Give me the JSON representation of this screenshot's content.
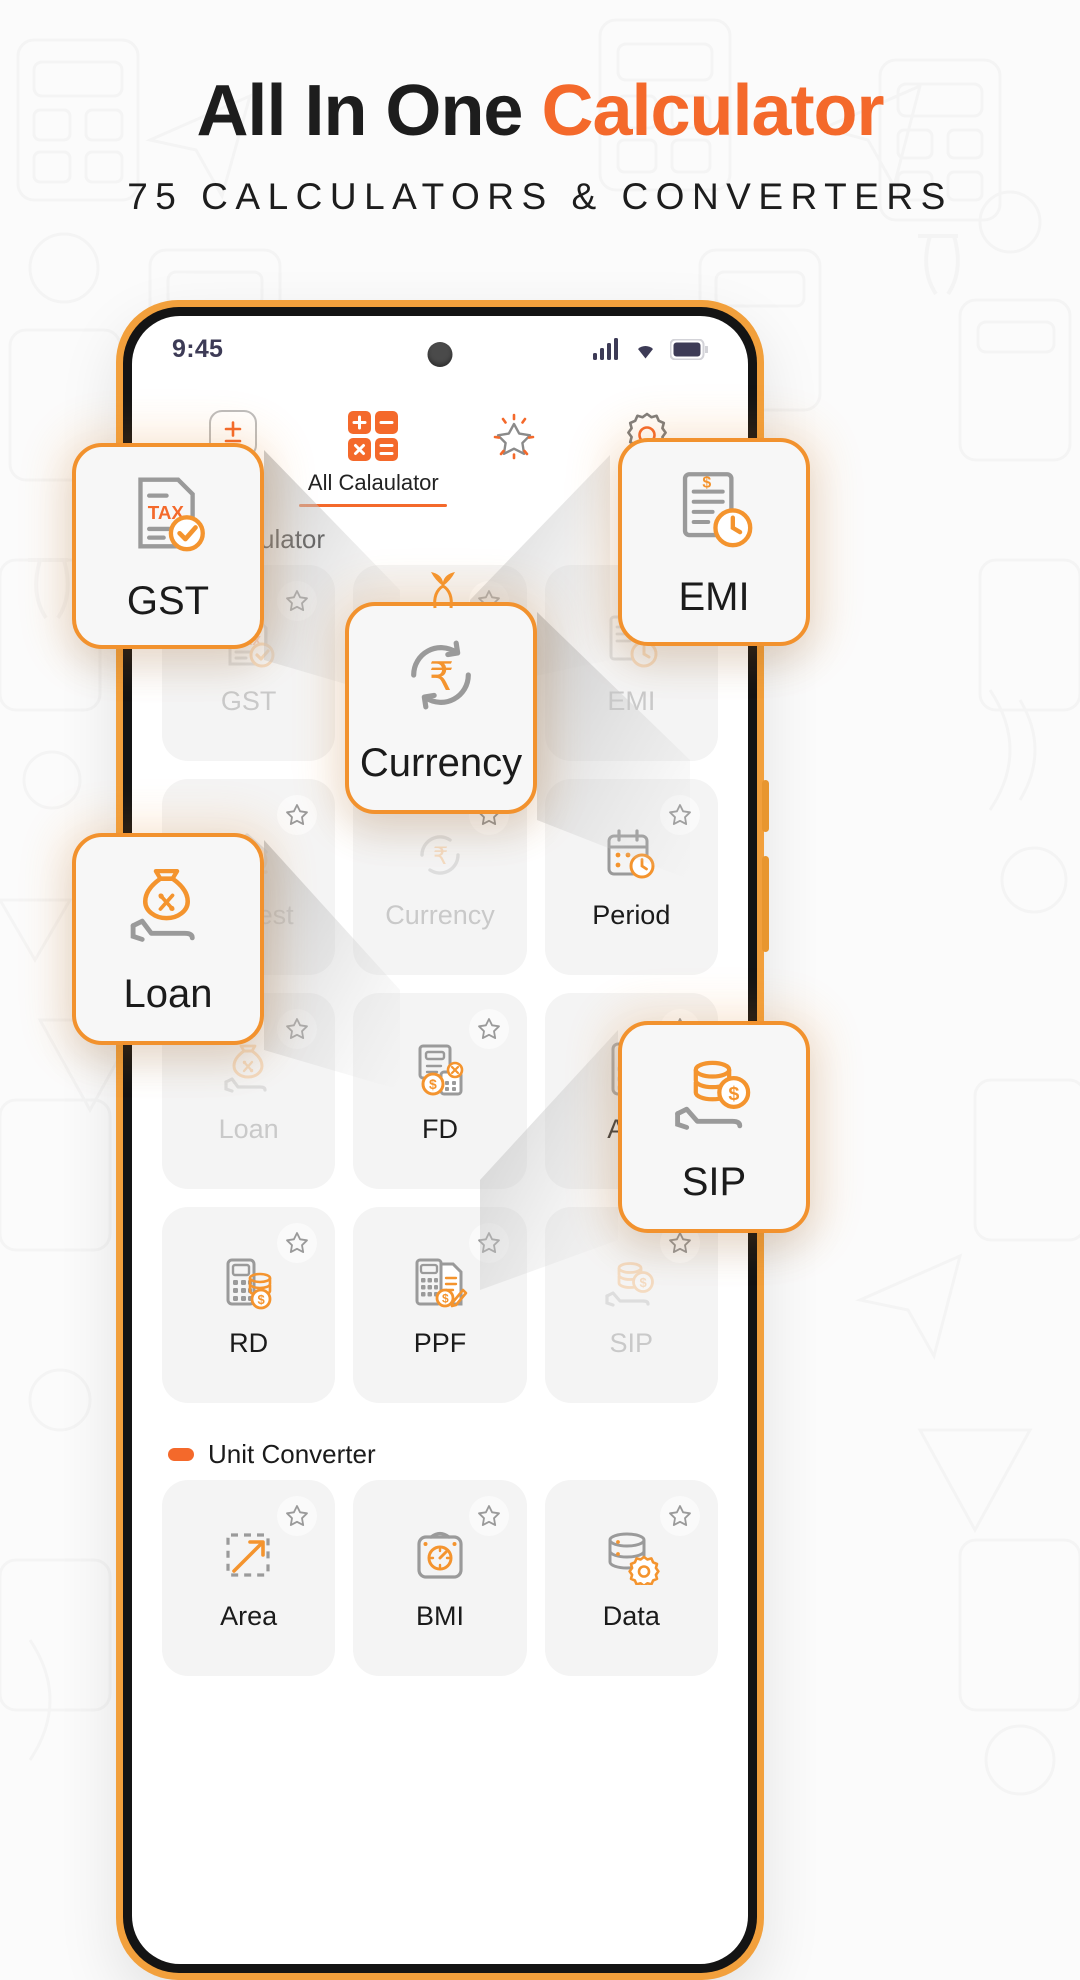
{
  "hero": {
    "title_part1": "All In One ",
    "title_part2": "Calculator",
    "subtitle": "75 CALCULATORS & CONVERTERS",
    "accent_color": "#f4692b",
    "title_color": "#1d1d1d"
  },
  "phone": {
    "frame_color": "#f2a03c",
    "statusbar": {
      "time": "9:45",
      "icons": [
        "signal-icon",
        "wifi-icon",
        "battery-icon"
      ]
    },
    "topnav": {
      "items": [
        {
          "icon": "plus-minus-icon",
          "label": ""
        },
        {
          "icon": "calculator-icon",
          "label": "All Calaulator",
          "active": true
        },
        {
          "icon": "star-sparkle-icon",
          "label": ""
        },
        {
          "icon": "gear-icon",
          "label": ""
        }
      ]
    },
    "sections": [
      {
        "title": "Calculator",
        "tiles": [
          {
            "label": "GST",
            "icon": "tax-document-icon",
            "dim": true
          },
          {
            "label": "Currency",
            "icon": "currency-refresh-icon",
            "dim": true
          },
          {
            "label": "EMI",
            "icon": "emi-clock-icon",
            "dim": true
          },
          {
            "label": "Interest",
            "icon": "home-percent-icon",
            "dim": true
          },
          {
            "label": "Currency",
            "icon": "currency-refresh-icon",
            "dim": true
          },
          {
            "label": "Period",
            "icon": "calendar-clock-icon",
            "dim": false
          },
          {
            "label": "Loan",
            "icon": "money-bag-hand-icon",
            "dim": true
          },
          {
            "label": "FD",
            "icon": "fd-calculator-icon",
            "dim": false
          },
          {
            "label": "Age",
            "icon": "age-calculator-icon",
            "dim": false
          },
          {
            "label": "RD",
            "icon": "rd-coins-icon",
            "dim": false
          },
          {
            "label": "PPF",
            "icon": "ppf-document-icon",
            "dim": false
          },
          {
            "label": "SIP",
            "icon": "sip-coins-hand-icon",
            "dim": true
          }
        ]
      },
      {
        "title": "Unit Converter",
        "tiles": [
          {
            "label": "Area",
            "icon": "area-arrow-icon",
            "dim": false
          },
          {
            "label": "BMI",
            "icon": "bmi-scale-icon",
            "dim": false
          },
          {
            "label": "Data",
            "icon": "database-gear-icon",
            "dim": false
          }
        ]
      }
    ],
    "highlight_cards": [
      {
        "id": "gst",
        "label": "GST",
        "icon": "tax-document-icon"
      },
      {
        "id": "emi",
        "label": "EMI",
        "icon": "emi-clock-icon"
      },
      {
        "id": "currency",
        "label": "Currency",
        "icon": "currency-refresh-icon"
      },
      {
        "id": "loan",
        "label": "Loan",
        "icon": "money-bag-hand-icon"
      },
      {
        "id": "sip",
        "label": "SIP",
        "icon": "sip-coins-hand-icon"
      }
    ]
  }
}
